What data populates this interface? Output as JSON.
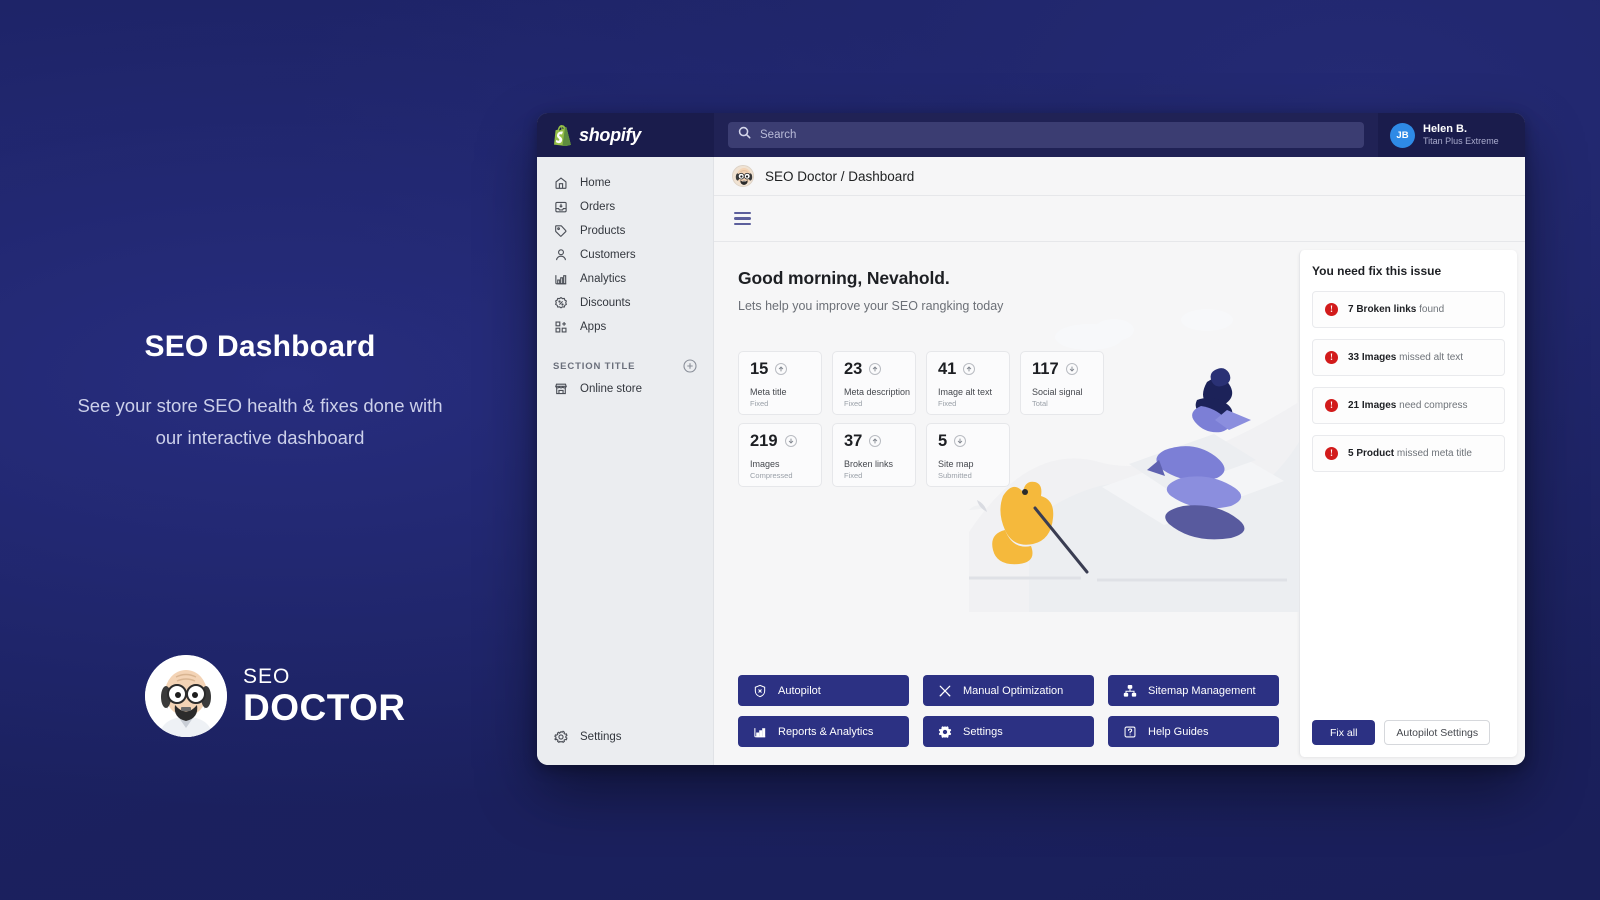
{
  "promo": {
    "title": "SEO Dashboard",
    "subtitle": "See your store SEO health & fixes done with our interactive dashboard",
    "logo_line1": "SEO",
    "logo_line2": "DOCTOR",
    "logo_icon": "seo-doctor-character-icon"
  },
  "topbar": {
    "brand": "shopify",
    "brand_icon": "shopify-bag-icon",
    "search_placeholder": "Search",
    "search_value": "",
    "search_icon": "search-icon",
    "user": {
      "initials": "JB",
      "name": "Helen B.",
      "plan": "Titan Plus Extreme"
    }
  },
  "sidebar": {
    "items": [
      {
        "label": "Home",
        "icon": "home-icon"
      },
      {
        "label": "Orders",
        "icon": "orders-inbox-icon"
      },
      {
        "label": "Products",
        "icon": "tag-icon"
      },
      {
        "label": "Customers",
        "icon": "person-icon"
      },
      {
        "label": "Analytics",
        "icon": "bar-chart-icon"
      },
      {
        "label": "Discounts",
        "icon": "discount-badge-icon"
      },
      {
        "label": "Apps",
        "icon": "apps-grid-icon"
      }
    ],
    "section_title": "SECTION TITLE",
    "add_icon": "plus-circle-icon",
    "section_items": [
      {
        "label": "Online store",
        "icon": "storefront-icon"
      }
    ],
    "settings": {
      "label": "Settings",
      "icon": "gear-icon"
    }
  },
  "breadcrumb": {
    "text": "SEO Doctor / Dashboard",
    "avatar_icon": "seo-doctor-avatar-icon",
    "menu_icon": "hamburger-menu-icon"
  },
  "main": {
    "greeting_title": "Good morning, Nevahold.",
    "greeting_subtitle": "Lets help you improve your SEO rangking today",
    "stats": [
      {
        "value": "15",
        "label": "Meta title",
        "sub": "Fixed",
        "trend": "up",
        "trend_icon": "arrow-up-circle-icon"
      },
      {
        "value": "23",
        "label": "Meta description",
        "sub": "Fixed",
        "trend": "up",
        "trend_icon": "arrow-up-circle-icon"
      },
      {
        "value": "41",
        "label": "Image alt text",
        "sub": "Fixed",
        "trend": "up",
        "trend_icon": "arrow-up-circle-icon"
      },
      {
        "value": "117",
        "label": "Social signal",
        "sub": "Total",
        "trend": "down",
        "trend_icon": "arrow-down-circle-icon"
      },
      {
        "value": "219",
        "label": "Images",
        "sub": "Compressed",
        "trend": "down",
        "trend_icon": "arrow-down-circle-icon"
      },
      {
        "value": "37",
        "label": "Broken links",
        "sub": "Fixed",
        "trend": "up",
        "trend_icon": "arrow-up-circle-icon"
      },
      {
        "value": "5",
        "label": "Site map",
        "sub": "Submitted",
        "trend": "down",
        "trend_icon": "arrow-down-circle-icon"
      }
    ],
    "actions": [
      {
        "label": "Autopilot",
        "icon": "shield-autopilot-icon"
      },
      {
        "label": "Manual Optimization",
        "icon": "tools-cross-icon"
      },
      {
        "label": "Sitemap Management",
        "icon": "sitemap-tree-icon"
      },
      {
        "label": "Reports & Analytics",
        "icon": "bar-chart-icon"
      },
      {
        "label": "Settings",
        "icon": "gear-icon"
      },
      {
        "label": "Help Guides",
        "icon": "question-box-icon"
      }
    ]
  },
  "issues_panel": {
    "title": "You need fix this issue",
    "alert_icon": "alert-exclamation-icon",
    "items": [
      {
        "strong": "7 Broken links",
        "rest": "found"
      },
      {
        "strong": "33 Images",
        "rest": "missed alt text"
      },
      {
        "strong": "21 Images",
        "rest": "need compress"
      },
      {
        "strong": "5 Product",
        "rest": "missed meta title"
      }
    ],
    "fix_all_label": "Fix all",
    "autopilot_settings_label": "Autopilot Settings"
  },
  "colors": {
    "page_bg": "#1d2366",
    "brand_navy": "#2c3183",
    "topbar": "#202255",
    "topbar_dark": "#1a1c4c",
    "sidebar": "#ebedf0",
    "alert_red": "#d21b1b",
    "avatar_blue": "#2e8ae6",
    "shopify_green": "#95bf47"
  }
}
